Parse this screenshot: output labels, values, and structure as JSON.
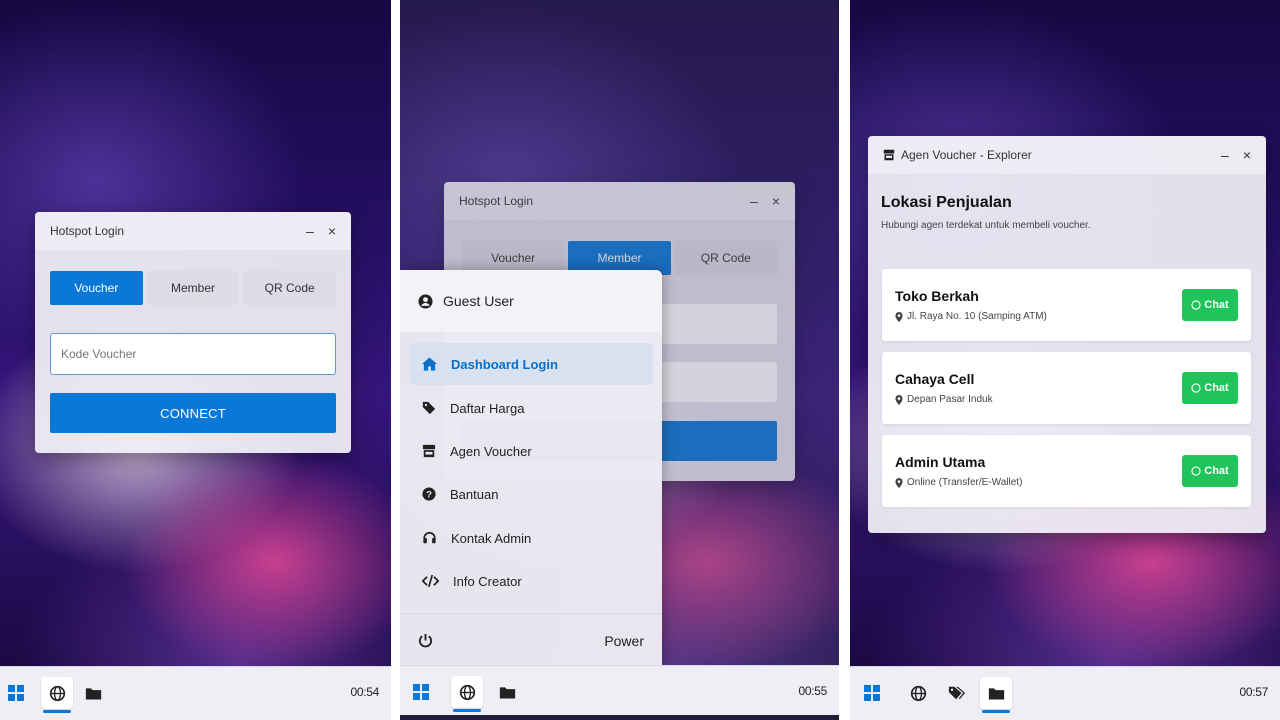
{
  "panel1": {
    "window": {
      "title": "Hotspot Login",
      "tabs": [
        {
          "label": "Voucher",
          "active": true
        },
        {
          "label": "Member",
          "active": false
        },
        {
          "label": "QR Code",
          "active": false
        }
      ],
      "voucher_placeholder": "Kode Voucher",
      "connect_label": "CONNECT"
    },
    "taskbar": {
      "clock": "00:54"
    }
  },
  "panel2": {
    "window": {
      "title": "Hotspot Login",
      "tabs": [
        {
          "label": "Voucher",
          "active": false
        },
        {
          "label": "Member",
          "active": true
        },
        {
          "label": "QR Code",
          "active": false
        }
      ]
    },
    "menu": {
      "user": "Guest User",
      "items": [
        {
          "label": "Dashboard Login",
          "icon": "home-icon",
          "active": true
        },
        {
          "label": "Daftar Harga",
          "icon": "tag-icon",
          "active": false
        },
        {
          "label": "Agen Voucher",
          "icon": "store-icon",
          "active": false
        },
        {
          "label": "Bantuan",
          "icon": "question-circle-icon",
          "active": false
        },
        {
          "label": "Kontak Admin",
          "icon": "headset-icon",
          "active": false
        },
        {
          "label": "Info Creator",
          "icon": "code-icon",
          "active": false
        }
      ],
      "power_label": "Power"
    },
    "taskbar": {
      "clock": "00:55"
    }
  },
  "panel3": {
    "window": {
      "title": "Agen Voucher - Explorer",
      "heading": "Lokasi Penjualan",
      "subheading": "Hubungi agen terdekat untuk membeli voucher.",
      "chat_label": "Chat",
      "agents": [
        {
          "name": "Toko Berkah",
          "location": "Jl. Raya No. 10 (Samping ATM)"
        },
        {
          "name": "Cahaya Cell",
          "location": "Depan Pasar Induk"
        },
        {
          "name": "Admin Utama",
          "location": "Online (Transfer/E-Wallet)"
        }
      ]
    },
    "taskbar": {
      "clock": "00:57"
    }
  },
  "colors": {
    "accent": "#0a78d7",
    "chat_green": "#20c45a"
  }
}
